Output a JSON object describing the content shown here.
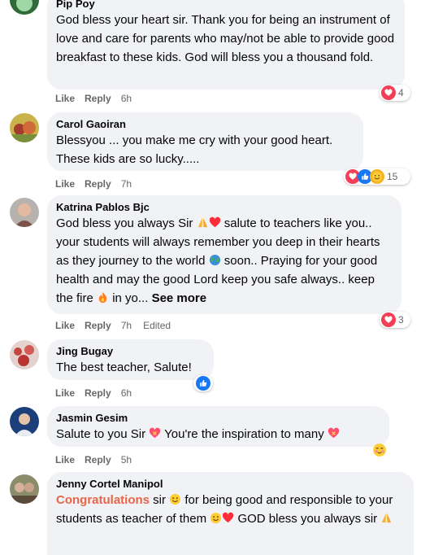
{
  "comments": [
    {
      "name": "Pip Poy",
      "text": "God bless your heart sir. Thank you for being an instrument of love and care for parents who may/not be able to provide good breakfast to these kids. God will bless you a thousand fold.",
      "like": "Like",
      "reply": "Reply",
      "time": "6h",
      "reaction_count": "4"
    },
    {
      "name": "Carol Gaoiran",
      "text": "Blessyou ... you make me cry with your good heart. These kids are so lucky.....",
      "like": "Like",
      "reply": "Reply",
      "time": "7h",
      "reaction_count": "15"
    },
    {
      "name": "Katrina Pablos Bjc",
      "text_1": "God bless you always Sir",
      "text_2": "salute to teachers like you.. your students will always remember you deep in their hearts as they journey to the world",
      "text_3": "soon.. Praying for your good health and may the good Lord keep you safe always.. keep the fire",
      "text_4": "in yo...",
      "see_more": "See more",
      "like": "Like",
      "reply": "Reply",
      "time": "7h",
      "edited": "Edited",
      "reaction_count": "3"
    },
    {
      "name": "Jing Bugay",
      "text": "The best teacher, Salute!",
      "like": "Like",
      "reply": "Reply",
      "time": "6h"
    },
    {
      "name": "Jasmin Gesim",
      "text_1": "Salute to you Sir",
      "text_2": "You're the inspiration to many",
      "like": "Like",
      "reply": "Reply",
      "time": "5h"
    },
    {
      "name": "Jenny Cortel Manipol",
      "highlight": "Congratulations",
      "text_1": "sir",
      "text_2": "for being good and responsible to your students as teacher of them",
      "text_3": "GOD bless you always sir"
    }
  ],
  "colors": {
    "bubble": "#f0f2f5",
    "meta": "#65676b",
    "heart": "#f33e58",
    "like": "#1877f2",
    "highlight": "#e8654a"
  },
  "icons": [
    "heart-reaction-icon",
    "like-reaction-icon",
    "care-reaction-icon",
    "praying-hands-emoji",
    "red-heart-emoji",
    "globe-emoji",
    "fire-emoji",
    "smiley-emoji",
    "heart-with-ribbon-emoji",
    "blushing-emoji"
  ]
}
